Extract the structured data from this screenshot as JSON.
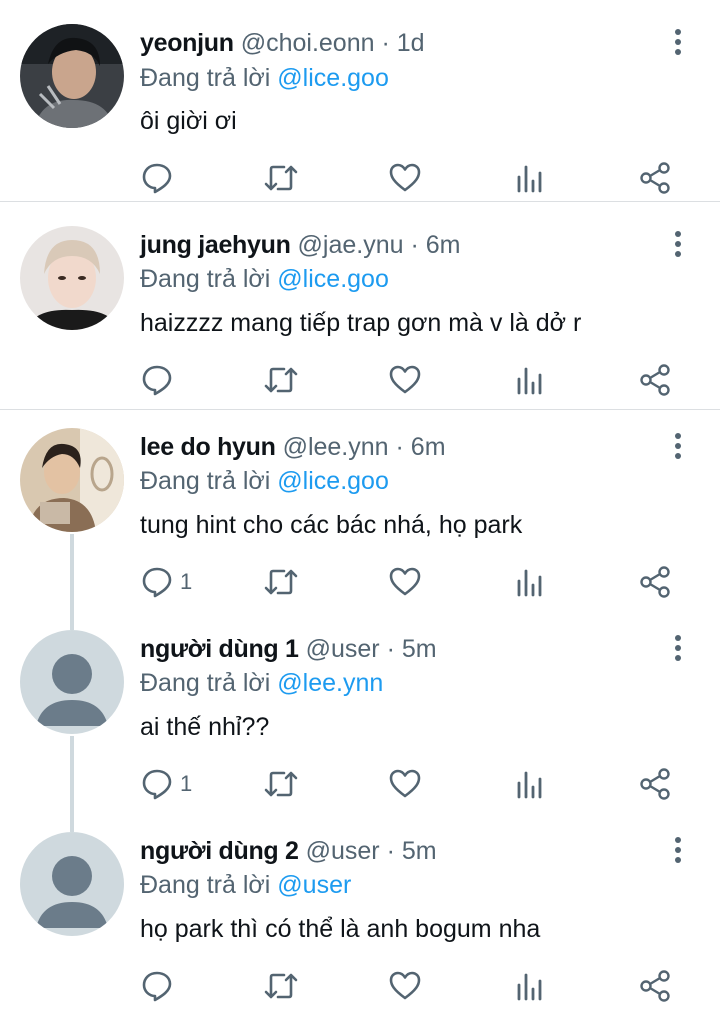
{
  "reply_prefix": "Đang trả lời",
  "tweets": [
    {
      "name": "yeonjun",
      "handle": "@choi.eonn",
      "dot": "·",
      "time": "1d",
      "reply_to": "@lice.goo",
      "text": "ôi giời ơi",
      "reply_count": "",
      "avatar": "photo-dark"
    },
    {
      "name": "jung jaehyun",
      "handle": "@jae.ynu",
      "dot": "·",
      "time": "6m",
      "reply_to": "@lice.goo",
      "text": "haizzzz mang tiếp trap gơn mà v là dở r",
      "reply_count": "",
      "avatar": "photo-light"
    },
    {
      "name": "lee do hyun",
      "handle": "@lee.ynn",
      "dot": "·",
      "time": "6m",
      "reply_to": "@lice.goo",
      "text": "tung hint cho các bác nhá, họ park",
      "reply_count": "1",
      "avatar": "photo-warm"
    },
    {
      "name": "người dùng 1",
      "handle": "@user",
      "dot": "·",
      "time": "5m",
      "reply_to": "@lee.ynn",
      "text": "ai thế nhỉ??",
      "reply_count": "1",
      "avatar": "default"
    },
    {
      "name": "người dùng 2",
      "handle": "@user",
      "dot": "·",
      "time": "5m",
      "reply_to": "@user",
      "text": "họ park thì có thể là anh bogum nha",
      "reply_count": "",
      "avatar": "default"
    }
  ],
  "icons": {
    "reply": "reply-icon",
    "retweet": "retweet-icon",
    "like": "heart-icon",
    "views": "analytics-icon",
    "share": "share-icon",
    "more": "more-vertical-icon"
  },
  "colors": {
    "mention": "#1d9bf0",
    "secondary": "#536471",
    "icon": "#536471",
    "divider": "#dcdfe2",
    "thread_line": "#cfd9de",
    "default_avatar_bg": "#cfd9de",
    "default_avatar_fg": "#6b7c8a"
  }
}
